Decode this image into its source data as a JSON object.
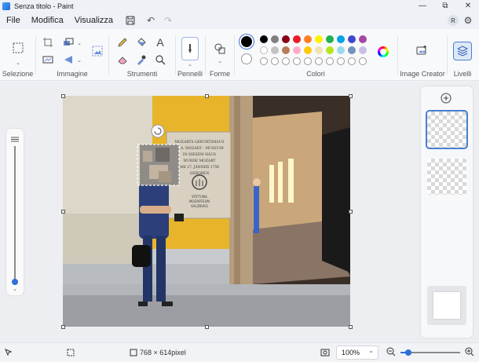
{
  "window": {
    "title": "Senza titolo - Paint"
  },
  "menu": {
    "file": "File",
    "modify": "Modifica",
    "view": "Visualizza"
  },
  "user": {
    "initial": "R"
  },
  "ribbon": {
    "selection_label": "Selezione",
    "image_label": "Immagine",
    "tools_label": "Strumenti",
    "brushes_label": "Pennelli",
    "shapes_label": "Forme",
    "colors_label": "Colori",
    "image_creator_label": "Image Creator",
    "layers_label": "Livelli",
    "text_tool_glyph": "A"
  },
  "colors": {
    "primary": "#000000",
    "row1": [
      "#000000",
      "#7f7f7f",
      "#880015",
      "#ed1c24",
      "#ff7f27",
      "#fff200",
      "#22b14c",
      "#00a2e8",
      "#3f48cc",
      "#a349a4"
    ],
    "row2": [
      "#ffffff",
      "#c3c3c3",
      "#b97a57",
      "#ffaec9",
      "#ffc90e",
      "#efe4b0",
      "#b5e61d",
      "#99d9ea",
      "#7092be",
      "#c8bfe7"
    ]
  },
  "canvas_art": {
    "sign_text": [
      "MOZARTS GEBURTSHAUS",
      "W. A. MOZART - MUSEUM",
      "IN DIESEM HAUS",
      "WURDE MOZART",
      "AM 27. JÄNNER 1756",
      "GEBOREN"
    ],
    "sign_footer": [
      "STIFTUNG",
      "MOZARTEUM",
      "SALZBURG"
    ]
  },
  "status": {
    "dimensions": "768 × 614pixel",
    "zoom": "100%"
  }
}
